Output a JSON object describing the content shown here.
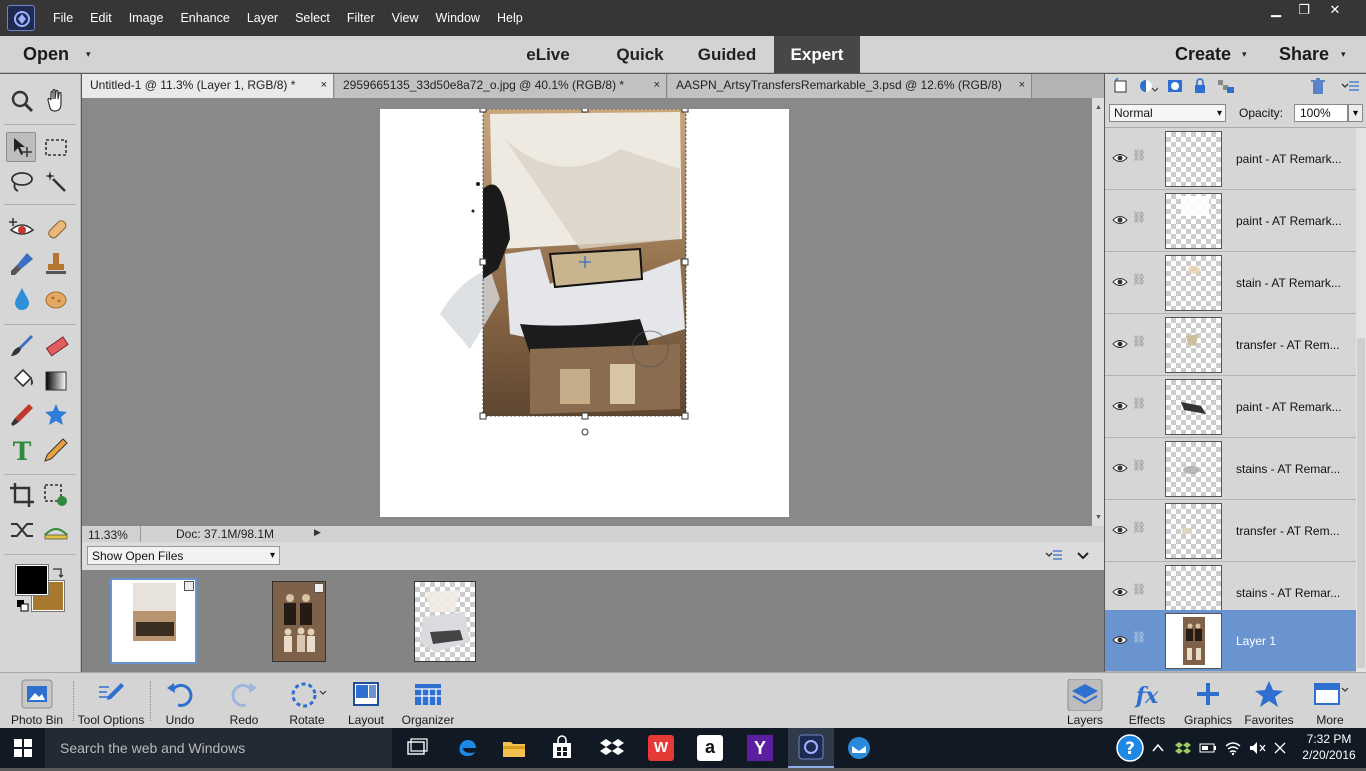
{
  "menu": [
    "File",
    "Edit",
    "Image",
    "Enhance",
    "Layer",
    "Select",
    "Filter",
    "View",
    "Window",
    "Help"
  ],
  "window_controls": {
    "minimize": "▁",
    "restore": "❐",
    "close": "✕"
  },
  "topbar": {
    "open": "Open",
    "caret": "▾",
    "modes": [
      "eLive",
      "Quick",
      "Guided",
      "Expert"
    ],
    "active_mode": "Expert",
    "create": "Create",
    "share": "Share"
  },
  "tabs": [
    {
      "label": "Untitled-1 @ 11.3% (Layer 1, RGB/8) *",
      "close": "×"
    },
    {
      "label": "2959665135_33d50e8a72_o.jpg @ 40.1% (RGB/8) *",
      "close": "×"
    },
    {
      "label": "AASPN_ArtsyTransfersRemarkable_3.psd @ 12.6% (RGB/8)",
      "close": "×"
    }
  ],
  "status": {
    "zoom": "11.33%",
    "doc": "Doc: 37.1M/98.1M"
  },
  "photo_bin": {
    "dropdown": "Show Open Files",
    "dropdown_caret": "▾"
  },
  "layers_panel": {
    "blend_mode": "Normal",
    "opacity_label": "Opacity:",
    "opacity": "100%"
  },
  "layers": [
    {
      "name": "paint - AT Remark..."
    },
    {
      "name": "paint - AT Remark..."
    },
    {
      "name": "stain - AT Remark..."
    },
    {
      "name": "transfer - AT Rem..."
    },
    {
      "name": "paint - AT Remark..."
    },
    {
      "name": "stains - AT Remar..."
    },
    {
      "name": "transfer - AT Rem..."
    },
    {
      "name": "stains - AT Remar..."
    },
    {
      "name": "Layer 1",
      "selected": true
    }
  ],
  "bottom_left": [
    "Photo Bin",
    "Tool Options",
    "Undo",
    "Redo",
    "Rotate",
    "Layout",
    "Organizer"
  ],
  "bottom_right": [
    "Layers",
    "Effects",
    "Graphics",
    "Favorites",
    "More"
  ],
  "effects_glyph": "fx",
  "type_tool_glyph": "T",
  "taskbar": {
    "search_placeholder": "Search the web and Windows",
    "time": "7:32 PM",
    "date": "2/20/2016",
    "help_glyph": "?",
    "wps_glyph": "W",
    "amazon_glyph": "a",
    "yahoo_glyph": "Y"
  },
  "colors": {
    "accent_selected": "#6a94cf",
    "foreground": "#000000",
    "background": "#a7782e"
  }
}
